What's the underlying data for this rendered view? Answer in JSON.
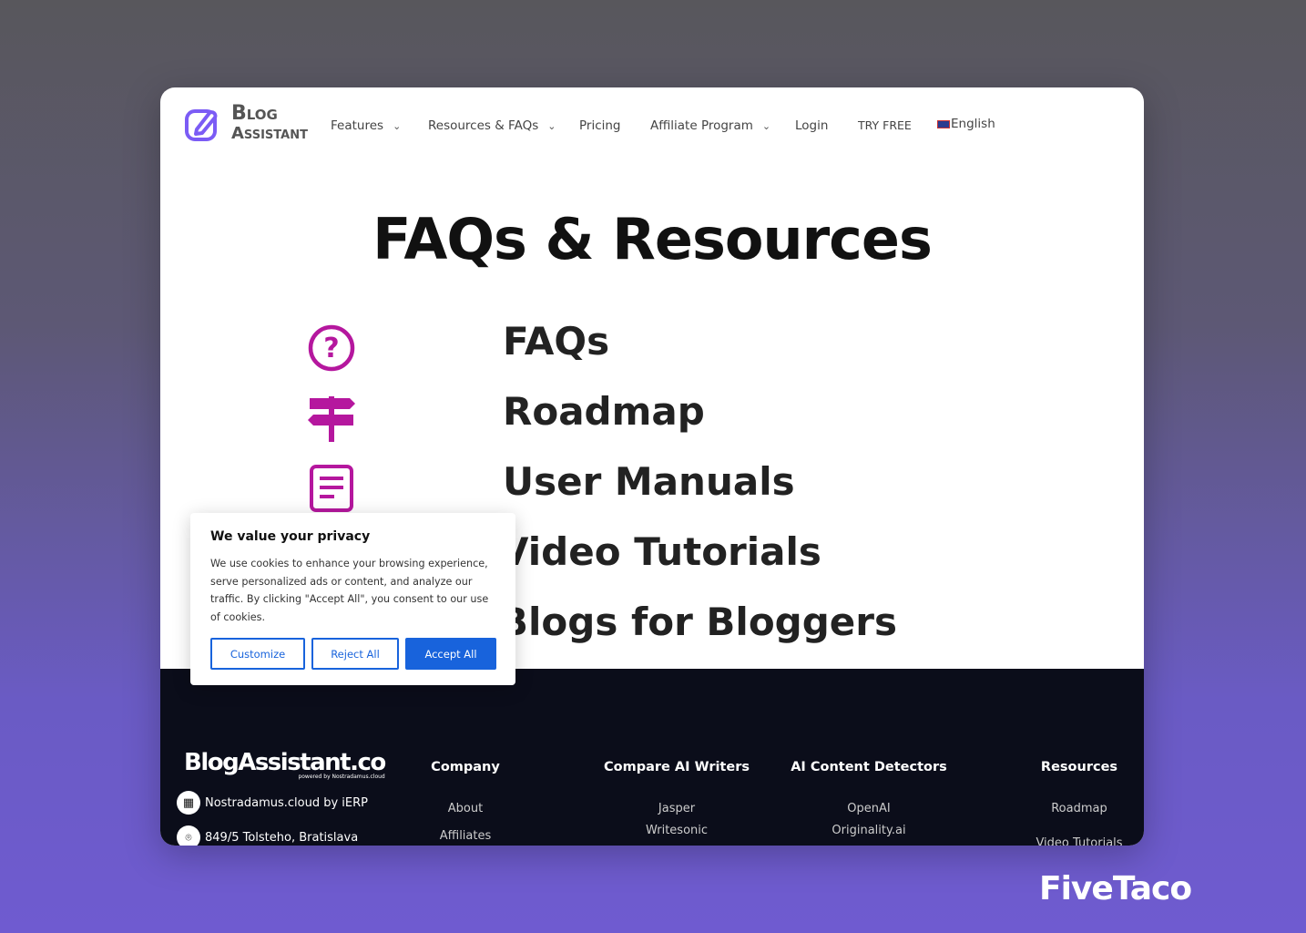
{
  "nav": {
    "logo_line1": "Blog",
    "logo_line2": "Assistant",
    "items": [
      {
        "label": "Features"
      },
      {
        "label": "Resources & FAQs"
      },
      {
        "label": "Pricing"
      },
      {
        "label": "Affiliate Program"
      },
      {
        "label": "Login"
      },
      {
        "label": "TRY FREE"
      },
      {
        "label": "English"
      }
    ]
  },
  "main": {
    "title": "FAQs & Resources",
    "resources": [
      {
        "label": "FAQs",
        "icon": "question-circle-icon"
      },
      {
        "label": "Roadmap",
        "icon": "signpost-icon"
      },
      {
        "label": "User Manuals",
        "icon": "document-icon"
      },
      {
        "label": "Video Tutorials"
      },
      {
        "label": "Blogs for Bloggers"
      }
    ],
    "accent": "#b5179e"
  },
  "footer": {
    "brand": "BlogAssistant.co",
    "brand_sub": "powered by Nostradamus.cloud",
    "company_name": "Nostradamus.cloud by iERP",
    "address": "849/5 Tolsteho, Bratislava",
    "columns": [
      {
        "title": "Company",
        "links": [
          "About",
          "Affiliates"
        ]
      },
      {
        "title": "Compare AI Writers",
        "links": [
          "Jasper",
          "Writesonic"
        ]
      },
      {
        "title": "AI Content Detectors",
        "links": [
          "OpenAI",
          "Originality.ai"
        ]
      },
      {
        "title": "Resources",
        "links": [
          "Roadmap",
          "Video Tutorials"
        ]
      }
    ]
  },
  "cookie": {
    "title": "We value your privacy",
    "body": "We use cookies to enhance your browsing experience, serve personalized ads or content, and analyze our traffic. By clicking \"Accept All\", you consent to our use of cookies.",
    "customize": "Customize",
    "reject": "Reject All",
    "accept": "Accept All"
  },
  "watermark": "FiveTaco"
}
